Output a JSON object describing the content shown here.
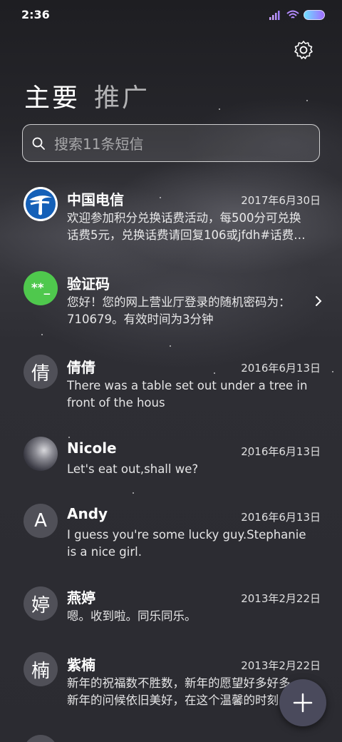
{
  "status_bar": {
    "time": "2:36",
    "icons": [
      "signal-icon",
      "wifi-icon",
      "battery-icon"
    ]
  },
  "header": {
    "settings_icon": "gear-icon",
    "tabs": [
      {
        "label": "主要",
        "active": true
      },
      {
        "label": "推广",
        "active": false
      }
    ]
  },
  "search": {
    "placeholder": "搜索11条短信",
    "icon": "search-icon"
  },
  "conversations": [
    {
      "name": "中国电信",
      "date": "2017年6月30日",
      "avatar": "china-telecom-logo",
      "preview": [
        "欢迎参加积分兑换话费活动，每500分可兑换",
        "话费5元，兑换话费请回复106或jfdh#话费…"
      ]
    },
    {
      "name": "验证码",
      "date": "",
      "avatar_text": "**_",
      "avatar_color": "#4fc84d",
      "preview": [
        "您好！您的网上营业厅登录的随机密码为：",
        "710679。有效时间为3分钟"
      ],
      "has_chevron": true
    },
    {
      "name": "倩倩",
      "date": "2016年6月13日",
      "avatar_text": "倩",
      "preview": [
        "There was a table set out under a tree in",
        "front of the hous"
      ]
    },
    {
      "name": "Nicole",
      "date": "2016年6月13日",
      "avatar": "photo",
      "preview": [
        "Let's eat out,shall we?"
      ]
    },
    {
      "name": "Andy",
      "date": "2016年6月13日",
      "avatar_text": "A",
      "preview": [
        "I guess you're some lucky guy.Stephanie",
        "is a nice girl."
      ]
    },
    {
      "name": "燕婷",
      "date": "2013年2月22日",
      "avatar_text": "婷",
      "preview": [
        "嗯。收到啦。同乐同乐。"
      ]
    },
    {
      "name": "紫楠",
      "date": "2013年2月22日",
      "avatar_text": "楠",
      "preview": [
        "新年的祝福数不胜数，新年的愿望好多好多，",
        "新年的问候依旧美好，在这个温馨的时刻"
      ]
    }
  ],
  "fab": {
    "icon": "plus-icon"
  }
}
